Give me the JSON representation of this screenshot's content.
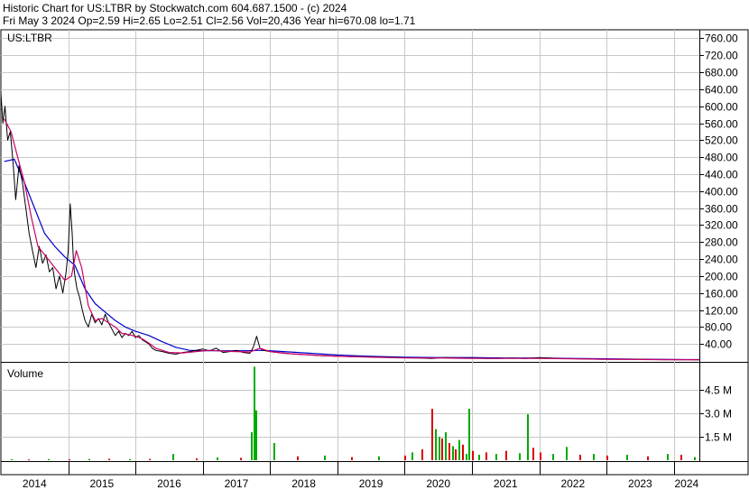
{
  "header": {
    "line1": "Historic Chart for US:LTBR by Stockwatch.com 604.687.1500 - (c) 2024",
    "line2": "Fri May  3 2024  Op=2.59  Hi=2.65  Lo=2.51  Cl=2.56  Vol=20,436  Year hi=670.08  lo=1.71"
  },
  "colors": {
    "price": "#000000",
    "ma_short": "#cc0066",
    "ma_long": "#0000cc",
    "vol_up": "#00aa00",
    "vol_down": "#dd0000",
    "grid": "#c8c8c8",
    "frame": "#000000"
  },
  "chart_data": [
    {
      "type": "line",
      "label": "US:LTBR",
      "x_labels": [
        "2014",
        "2015",
        "2016",
        "2017",
        "2018",
        "2019",
        "2020",
        "2021",
        "2022",
        "2023",
        "2024"
      ],
      "y_ticks": [
        "40.00",
        "80.00",
        "120.00",
        "160.00",
        "200.00",
        "240.00",
        "280.00",
        "320.00",
        "360.00",
        "400.00",
        "440.00",
        "480.00",
        "520.00",
        "560.00",
        "600.00",
        "640.00",
        "680.00",
        "720.00",
        "760.00"
      ],
      "ylim": [
        0,
        780
      ],
      "xlim": [
        2014.0,
        2024.38
      ],
      "grid": true,
      "series": [
        {
          "key": "price",
          "x": [
            2014.0,
            2014.03,
            2014.06,
            2014.1,
            2014.14,
            2014.18,
            2014.22,
            2014.27,
            2014.32,
            2014.37,
            2014.42,
            2014.47,
            2014.52,
            2014.57,
            2014.62,
            2014.67,
            2014.72,
            2014.77,
            2014.82,
            2014.87,
            2014.92,
            2014.97,
            2015.0,
            2015.03,
            2015.06,
            2015.08,
            2015.1,
            2015.13,
            2015.17,
            2015.21,
            2015.25,
            2015.3,
            2015.35,
            2015.4,
            2015.45,
            2015.5,
            2015.55,
            2015.6,
            2015.65,
            2015.7,
            2015.75,
            2015.8,
            2015.85,
            2015.9,
            2015.95,
            2016.0,
            2016.05,
            2016.1,
            2016.15,
            2016.2,
            2016.25,
            2016.3,
            2016.4,
            2016.5,
            2016.6,
            2016.7,
            2016.8,
            2016.9,
            2017.0,
            2017.1,
            2017.2,
            2017.3,
            2017.4,
            2017.5,
            2017.6,
            2017.7,
            2017.75,
            2017.8,
            2017.85,
            2017.9,
            2018.0,
            2018.2,
            2018.4,
            2018.6,
            2018.8,
            2019.0,
            2019.3,
            2019.6,
            2019.9,
            2020.2,
            2020.4,
            2020.6,
            2020.8,
            2021.0,
            2021.2,
            2021.4,
            2021.6,
            2021.8,
            2022.0,
            2022.3,
            2022.6,
            2022.9,
            2023.2,
            2023.5,
            2023.8,
            2024.1,
            2024.38
          ],
          "y": [
            630,
            560,
            600,
            520,
            540,
            470,
            380,
            460,
            420,
            360,
            300,
            260,
            220,
            270,
            230,
            250,
            210,
            220,
            170,
            200,
            160,
            210,
            260,
            370,
            300,
            230,
            200,
            170,
            150,
            120,
            95,
            80,
            110,
            90,
            100,
            85,
            110,
            90,
            75,
            60,
            70,
            55,
            65,
            60,
            70,
            55,
            60,
            50,
            45,
            40,
            30,
            25,
            22,
            18,
            16,
            20,
            22,
            25,
            28,
            24,
            30,
            20,
            22,
            25,
            20,
            18,
            32,
            58,
            30,
            25,
            22,
            18,
            16,
            14,
            12,
            11,
            10,
            9,
            8,
            7,
            6,
            8,
            7,
            7,
            6,
            6,
            7,
            6,
            8,
            6,
            5,
            4,
            4,
            4,
            3,
            3,
            2.56
          ]
        },
        {
          "key": "ma_short",
          "x": [
            2014.05,
            2014.15,
            2014.25,
            2014.35,
            2014.45,
            2014.55,
            2014.65,
            2014.75,
            2014.85,
            2014.95,
            2015.05,
            2015.12,
            2015.2,
            2015.3,
            2015.4,
            2015.5,
            2015.6,
            2015.7,
            2015.8,
            2015.9,
            2016.0,
            2016.1,
            2016.2,
            2016.3,
            2016.5,
            2016.7,
            2016.9,
            2017.1,
            2017.3,
            2017.5,
            2017.7,
            2017.85,
            2018.0,
            2018.3,
            2018.6,
            2019.0,
            2019.5,
            2020.0,
            2020.5,
            2021.0,
            2021.5,
            2022.0,
            2022.5,
            2023.0,
            2023.5,
            2024.0,
            2024.38
          ],
          "y": [
            570,
            540,
            480,
            420,
            340,
            270,
            250,
            230,
            210,
            190,
            200,
            260,
            220,
            130,
            95,
            100,
            90,
            80,
            65,
            62,
            58,
            52,
            42,
            30,
            20,
            19,
            22,
            25,
            23,
            22,
            21,
            30,
            22,
            17,
            14,
            11,
            9,
            7,
            7,
            6,
            6,
            6,
            5,
            4,
            3.5,
            3,
            2.8
          ]
        },
        {
          "key": "ma_long",
          "x": [
            2014.05,
            2014.2,
            2014.35,
            2014.5,
            2014.65,
            2014.8,
            2014.95,
            2015.1,
            2015.25,
            2015.4,
            2015.55,
            2015.7,
            2015.85,
            2016.0,
            2016.2,
            2016.4,
            2016.6,
            2016.8,
            2017.0,
            2017.3,
            2017.6,
            2017.9,
            2018.2,
            2018.6,
            2019.0,
            2019.5,
            2020.0,
            2020.5,
            2021.0,
            2021.5,
            2022.0,
            2022.5,
            2023.0,
            2023.5,
            2024.0,
            2024.38
          ],
          "y": [
            470,
            475,
            420,
            360,
            300,
            270,
            245,
            225,
            170,
            135,
            115,
            95,
            80,
            70,
            60,
            45,
            32,
            25,
            24,
            24,
            24,
            25,
            22,
            18,
            14,
            11,
            9,
            8,
            8,
            7,
            7,
            6,
            5,
            4,
            3.5,
            3.2
          ]
        }
      ]
    },
    {
      "type": "bar",
      "label": "Volume",
      "y_ticks": [
        "1.5 M",
        "3.0 M",
        "4.5 M"
      ],
      "ylim": [
        0,
        6200000
      ],
      "x": [
        2014.15,
        2014.4,
        2014.7,
        2015.0,
        2015.3,
        2015.6,
        2015.9,
        2016.2,
        2016.55,
        2016.9,
        2017.2,
        2017.55,
        2017.72,
        2017.75,
        2017.78,
        2018.05,
        2018.4,
        2018.8,
        2019.2,
        2019.6,
        2020.0,
        2020.1,
        2020.25,
        2020.4,
        2020.45,
        2020.5,
        2020.55,
        2020.6,
        2020.65,
        2020.7,
        2020.75,
        2020.8,
        2020.85,
        2020.9,
        2020.95,
        2021.0,
        2021.1,
        2021.2,
        2021.35,
        2021.5,
        2021.7,
        2021.82,
        2021.9,
        2022.0,
        2022.2,
        2022.4,
        2022.6,
        2022.8,
        2023.0,
        2023.3,
        2023.6,
        2023.9,
        2024.1,
        2024.3
      ],
      "values": [
        60000,
        50000,
        70000,
        60000,
        80000,
        90000,
        70000,
        80000,
        400000,
        120000,
        180000,
        150000,
        1800000,
        6000000,
        3200000,
        1100000,
        250000,
        300000,
        200000,
        250000,
        300000,
        500000,
        700000,
        3300000,
        2000000,
        1500000,
        1400000,
        1800000,
        1100000,
        900000,
        700000,
        1300000,
        1000000,
        400000,
        3300000,
        600000,
        350000,
        500000,
        400000,
        600000,
        450000,
        2950000,
        800000,
        500000,
        400000,
        850000,
        350000,
        400000,
        300000,
        350000,
        250000,
        400000,
        350000,
        200000
      ],
      "up": [
        true,
        false,
        true,
        false,
        true,
        false,
        true,
        false,
        true,
        false,
        true,
        false,
        true,
        true,
        true,
        true,
        false,
        true,
        false,
        true,
        false,
        true,
        false,
        false,
        true,
        true,
        false,
        true,
        false,
        true,
        false,
        true,
        false,
        true,
        true,
        false,
        true,
        false,
        true,
        false,
        true,
        true,
        false,
        false,
        true,
        true,
        false,
        true,
        false,
        true,
        false,
        true,
        false,
        true
      ]
    }
  ]
}
